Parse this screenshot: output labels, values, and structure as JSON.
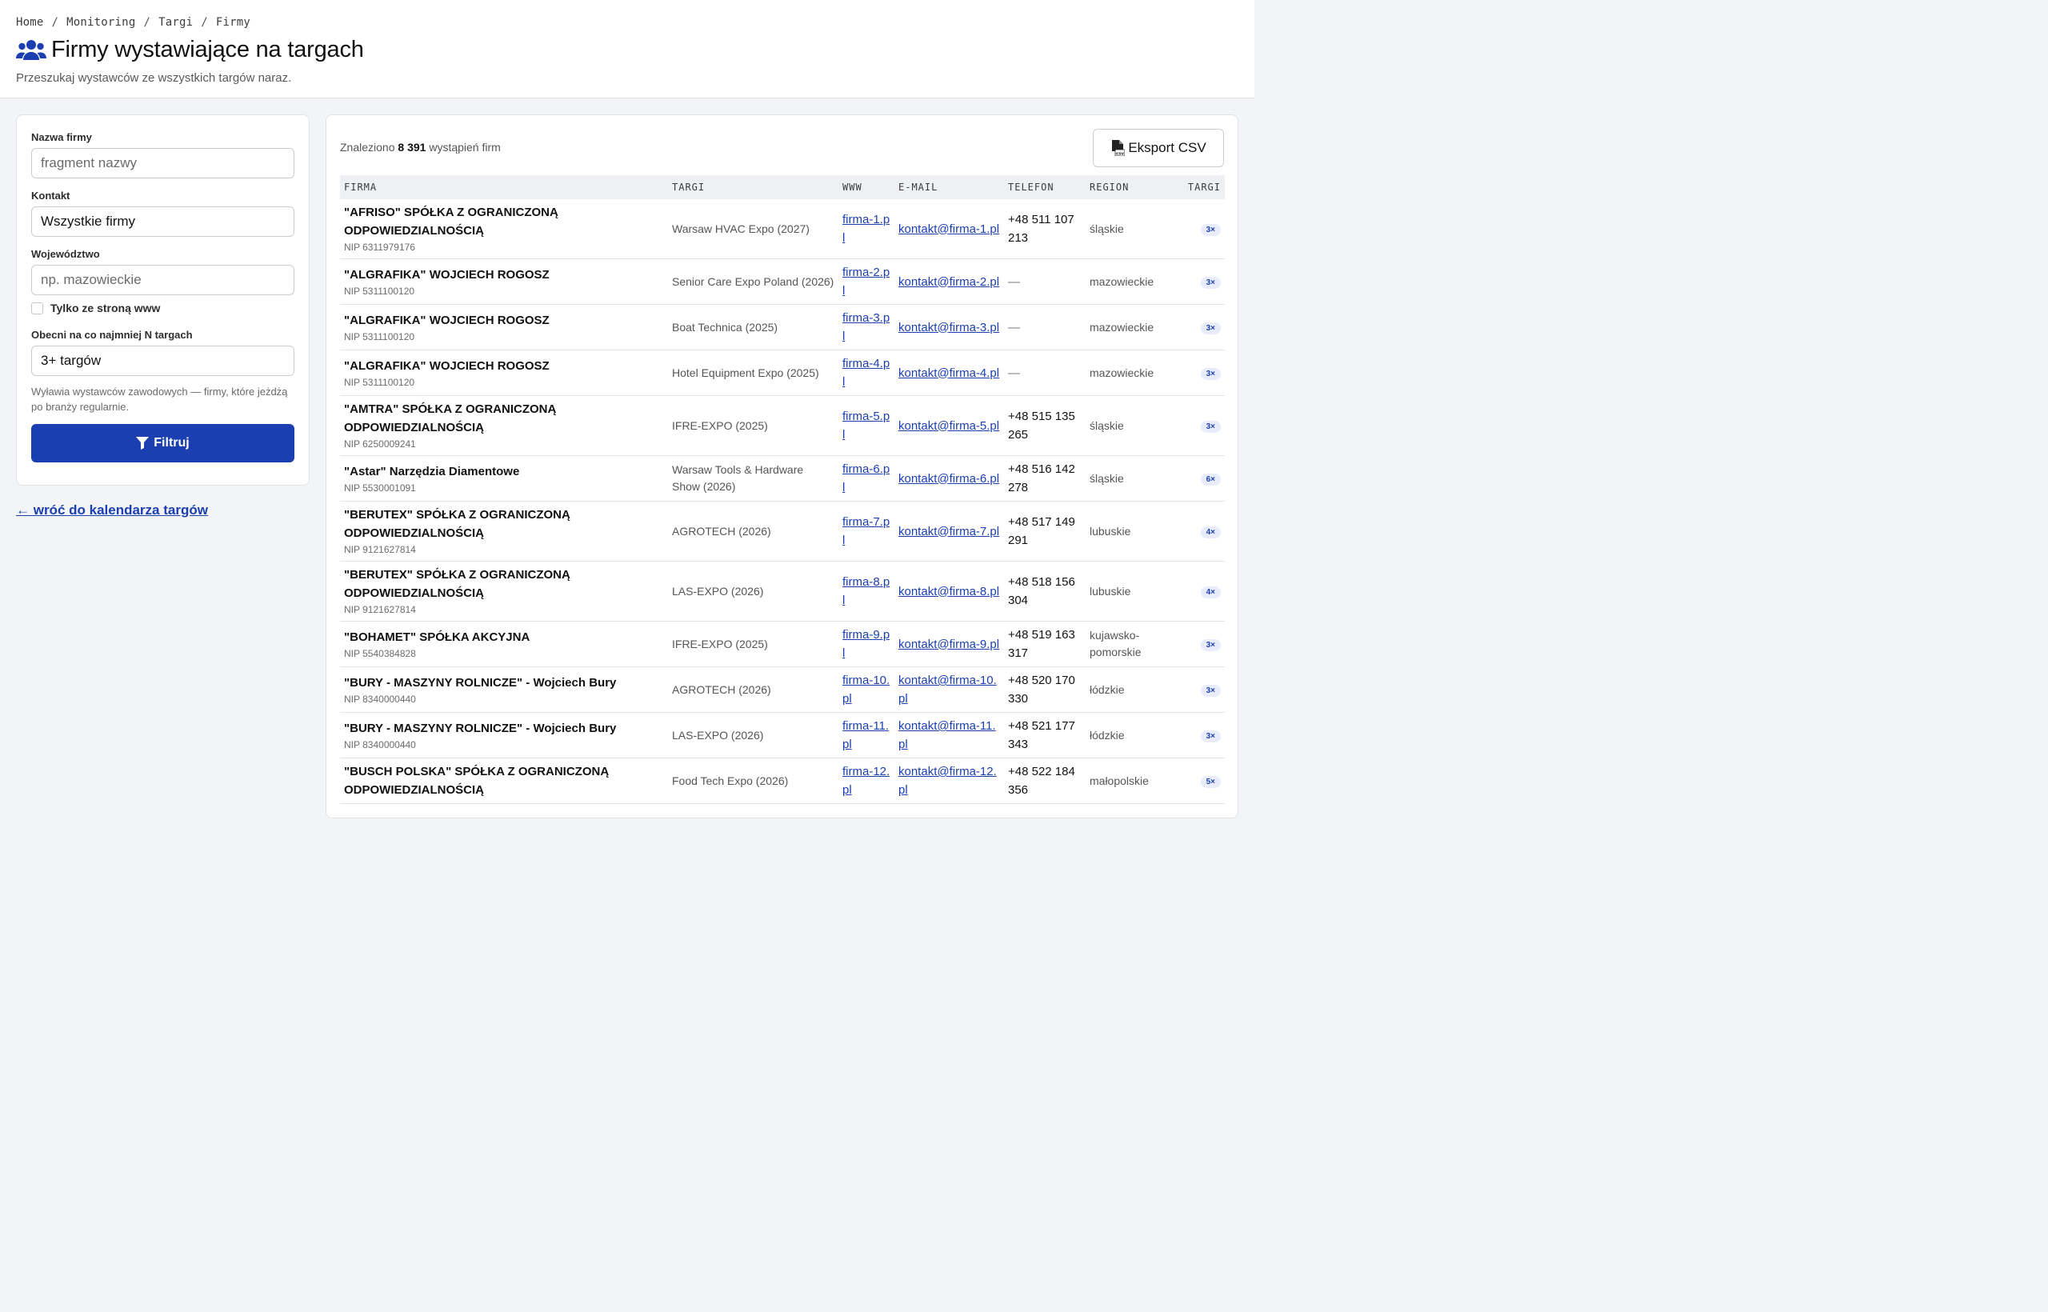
{
  "breadcrumb": [
    "Home",
    "Monitoring",
    "Targi",
    "Firmy"
  ],
  "page": {
    "title": "Firmy wystawiające na targach",
    "subtitle": "Przeszukaj wystawców ze wszystkich targów naraz.",
    "title_icon": "users-icon"
  },
  "filters": {
    "company_label": "Nazwa firmy",
    "company_placeholder": "fragment nazwy",
    "contact_label": "Kontakt",
    "contact_value": "Wszystkie firmy",
    "region_label": "Województwo",
    "region_placeholder": "np. mazowieckie",
    "www_only_label": "Tylko ze stroną www",
    "www_only_checked": false,
    "min_fairs_label": "Obecni na co najmniej N targach",
    "min_fairs_value": "3+ targów",
    "min_fairs_hint": "Wyławia wystawców zawodowych — firmy, które jeżdżą po branży regularnie.",
    "filter_button": "Filtruj"
  },
  "back_link": "← wróć do kalendarza targów",
  "results": {
    "summary_prefix": "Znaleziono",
    "count": "8 391",
    "summary_suffix": "wystąpień firm",
    "export_button": "Eksport CSV",
    "columns": [
      "FIRMA",
      "TARGI",
      "WWW",
      "E-MAIL",
      "TELEFON",
      "REGION",
      "TARGI"
    ],
    "rows": [
      {
        "name": "\"AFRISO\" SPÓŁKA Z OGRANICZONĄ ODPOWIEDZIALNOŚCIĄ",
        "nip": "NIP 6311979176",
        "fair": "Warsaw HVAC Expo (2027)",
        "www": "firma-1.pl",
        "email": "kontakt@firma-1.pl",
        "phone": "+48 511 107 213",
        "region": "śląskie",
        "count": "3×"
      },
      {
        "name": "\"ALGRAFIKA\" WOJCIECH ROGOSZ",
        "nip": "NIP 5311100120",
        "fair": "Senior Care Expo Poland (2026)",
        "www": "firma-2.pl",
        "email": "kontakt@firma-2.pl",
        "phone": "—",
        "region": "mazowieckie",
        "count": "3×"
      },
      {
        "name": "\"ALGRAFIKA\" WOJCIECH ROGOSZ",
        "nip": "NIP 5311100120",
        "fair": "Boat Technica (2025)",
        "www": "firma-3.pl",
        "email": "kontakt@firma-3.pl",
        "phone": "—",
        "region": "mazowieckie",
        "count": "3×"
      },
      {
        "name": "\"ALGRAFIKA\" WOJCIECH ROGOSZ",
        "nip": "NIP 5311100120",
        "fair": "Hotel Equipment Expo (2025)",
        "www": "firma-4.pl",
        "email": "kontakt@firma-4.pl",
        "phone": "—",
        "region": "mazowieckie",
        "count": "3×"
      },
      {
        "name": "\"AMTRA\" SPÓŁKA Z OGRANICZONĄ ODPOWIEDZIALNOŚCIĄ",
        "nip": "NIP 6250009241",
        "fair": "IFRE-EXPO (2025)",
        "www": "firma-5.pl",
        "email": "kontakt@firma-5.pl",
        "phone": "+48 515 135 265",
        "region": "śląskie",
        "count": "3×"
      },
      {
        "name": "\"Astar\" Narzędzia Diamentowe",
        "nip": "NIP 5530001091",
        "fair": "Warsaw Tools & Hardware Show (2026)",
        "www": "firma-6.pl",
        "email": "kontakt@firma-6.pl",
        "phone": "+48 516 142 278",
        "region": "śląskie",
        "count": "6×"
      },
      {
        "name": "\"BERUTEX\" SPÓŁKA Z OGRANICZONĄ ODPOWIEDZIALNOŚCIĄ",
        "nip": "NIP 9121627814",
        "fair": "AGROTECH (2026)",
        "www": "firma-7.pl",
        "email": "kontakt@firma-7.pl",
        "phone": "+48 517 149 291",
        "region": "lubuskie",
        "count": "4×"
      },
      {
        "name": "\"BERUTEX\" SPÓŁKA Z OGRANICZONĄ ODPOWIEDZIALNOŚCIĄ",
        "nip": "NIP 9121627814",
        "fair": "LAS-EXPO (2026)",
        "www": "firma-8.pl",
        "email": "kontakt@firma-8.pl",
        "phone": "+48 518 156 304",
        "region": "lubuskie",
        "count": "4×"
      },
      {
        "name": "\"BOHAMET\" SPÓŁKA AKCYJNA",
        "nip": "NIP 5540384828",
        "fair": "IFRE-EXPO (2025)",
        "www": "firma-9.pl",
        "email": "kontakt@firma-9.pl",
        "phone": "+48 519 163 317",
        "region": "kujawsko-pomorskie",
        "count": "3×"
      },
      {
        "name": "\"BURY - MASZYNY ROLNICZE\" - Wojciech Bury",
        "nip": "NIP 8340000440",
        "fair": "AGROTECH (2026)",
        "www": "firma-10.pl",
        "email": "kontakt@firma-10.pl",
        "phone": "+48 520 170 330",
        "region": "łódzkie",
        "count": "3×"
      },
      {
        "name": "\"BURY - MASZYNY ROLNICZE\" - Wojciech Bury",
        "nip": "NIP 8340000440",
        "fair": "LAS-EXPO (2026)",
        "www": "firma-11.pl",
        "email": "kontakt@firma-11.pl",
        "phone": "+48 521 177 343",
        "region": "łódzkie",
        "count": "3×"
      },
      {
        "name": "\"BUSCH POLSKA\" SPÓŁKA Z OGRANICZONĄ ODPOWIEDZIALNOŚCIĄ",
        "nip": "",
        "fair": "Food Tech Expo (2026)",
        "www": "firma-12.pl",
        "email": "kontakt@firma-12.pl",
        "phone": "+48 522 184 356",
        "region": "małopolskie",
        "count": "5×"
      }
    ]
  },
  "colors": {
    "accent": "#1b3fb0",
    "badge_bg": "#e9edfb"
  }
}
